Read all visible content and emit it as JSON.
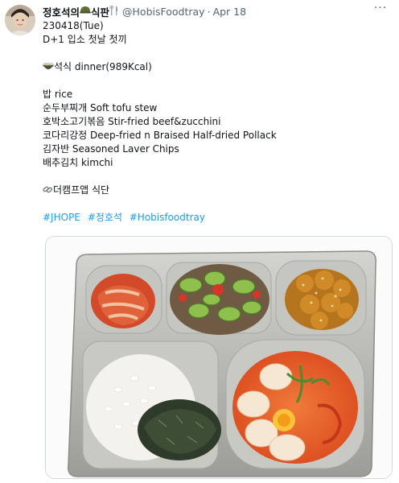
{
  "user": {
    "display_name": "정호석의",
    "name_suffix": "식판",
    "handle": "@HobisFoodtray",
    "separator": "·",
    "date": "Apr 18",
    "more_label": "···"
  },
  "tweet": {
    "date_code": "230418(Tue)",
    "subtitle": "D+1 입소 첫날 첫끼",
    "meal_heading": "석식 dinner(989Kcal)",
    "menu": [
      "밥 rice",
      "순두부찌개 Soft tofu stew",
      "호박소고기볶음 Stir-fried beef&zucchini",
      "코다리강정 Deep-fried n Braised Half-dried Pollack",
      "김자반 Seasoned Laver Chips",
      "배추김치 kimchi"
    ],
    "app_link": "더캠프앱 식단",
    "hashtags": [
      "#JHOPE",
      "#정호석",
      "#Hobisfoodtray"
    ]
  },
  "colors": {
    "link": "#1d9bf0",
    "secondary_text": "#536471",
    "tray": "#b9b9b4"
  },
  "icons": {
    "name_emoji": "helmet-icon",
    "utensils": "fork-knife-icon",
    "meal_emoji": "meal-bowl-icon",
    "link_emoji": "link-icon",
    "more": "more-horizontal-icon"
  }
}
